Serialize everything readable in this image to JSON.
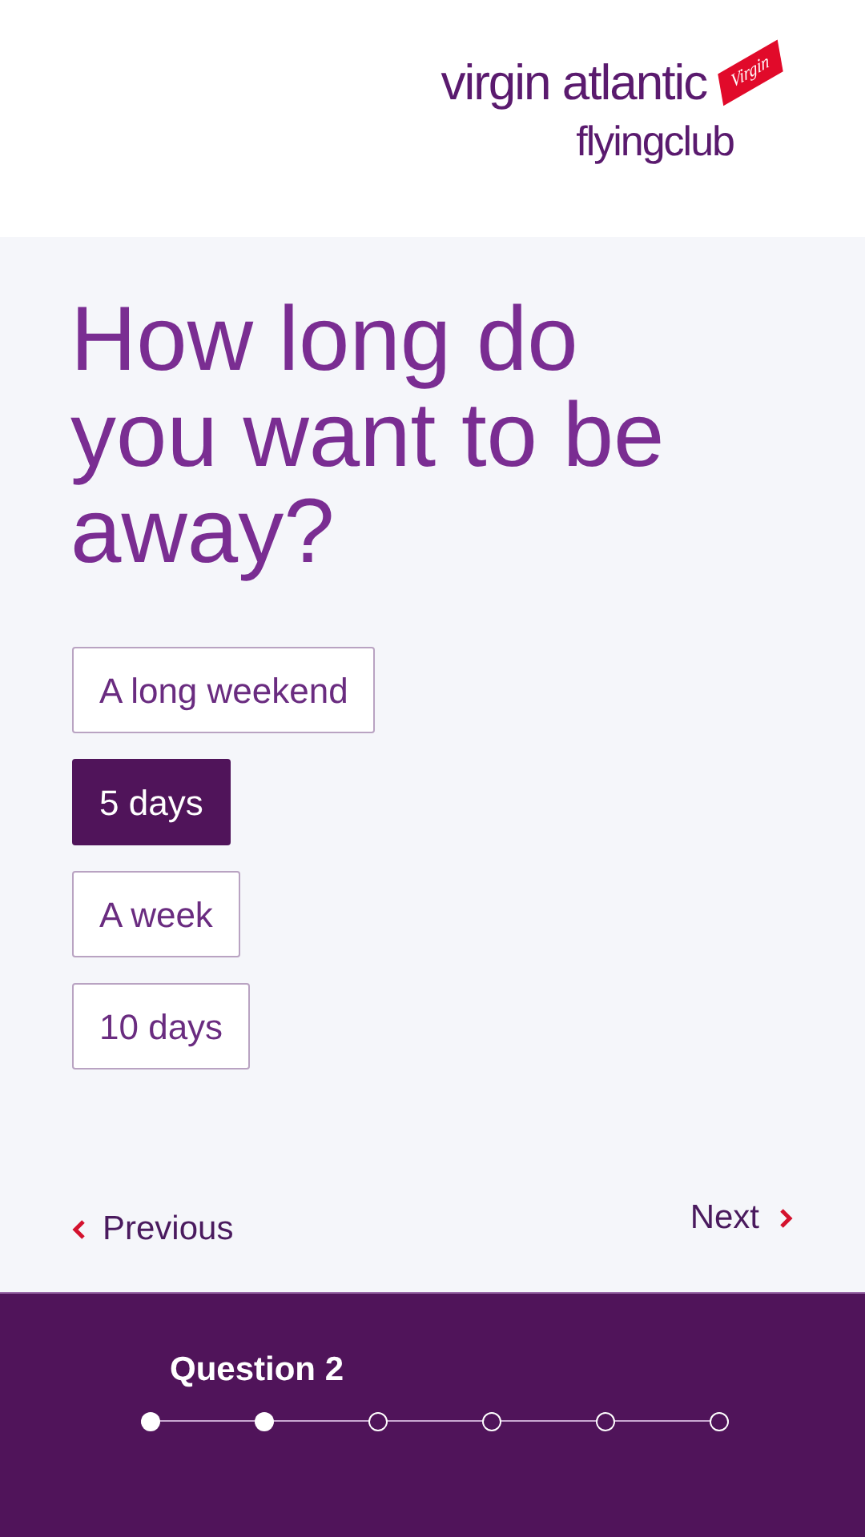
{
  "logo": {
    "brand": "virgin atlantic",
    "tag": "Virgin",
    "club": "flyingclub"
  },
  "question": "How long do you want to be away?",
  "options": [
    {
      "label": "A long weekend",
      "selected": false
    },
    {
      "label": "5 days",
      "selected": true
    },
    {
      "label": "A week",
      "selected": false
    },
    {
      "label": "10 days",
      "selected": false
    }
  ],
  "nav": {
    "previous": "Previous",
    "next": "Next"
  },
  "progress": {
    "label": "Question 2",
    "steps": [
      {
        "done": true
      },
      {
        "done": true
      },
      {
        "done": false
      },
      {
        "done": false
      },
      {
        "done": false
      },
      {
        "done": false
      }
    ]
  }
}
